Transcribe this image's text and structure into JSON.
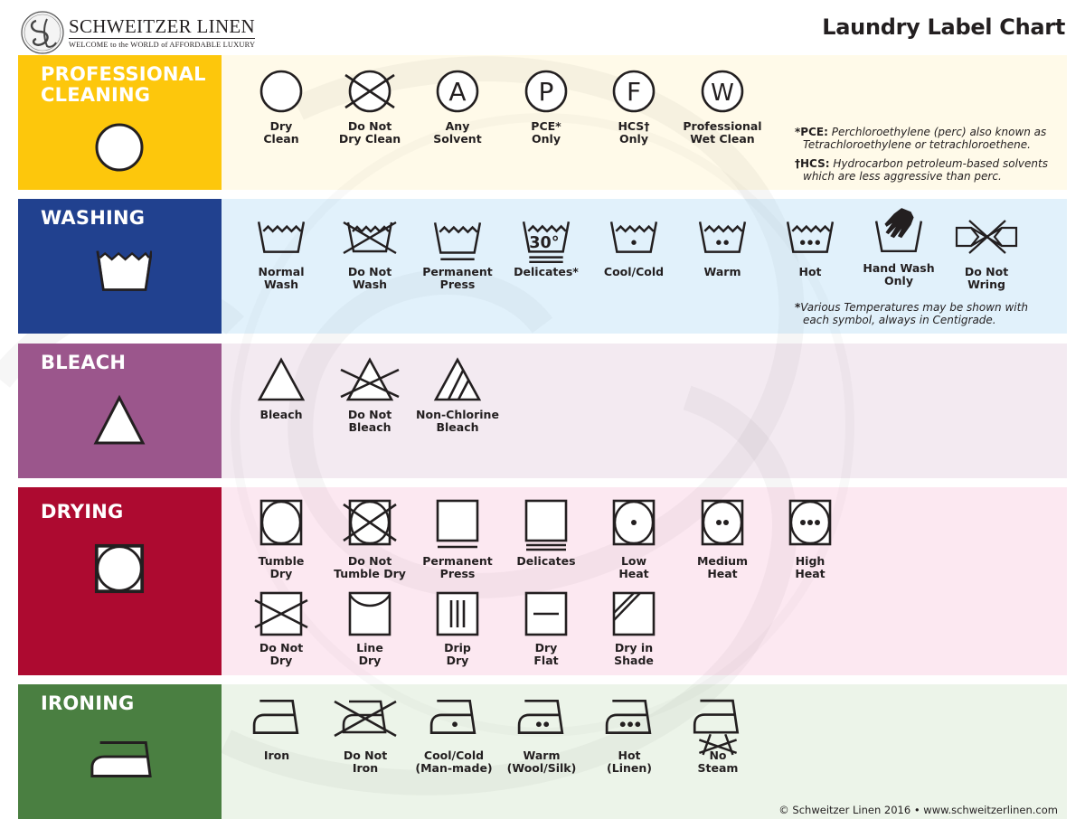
{
  "header": {
    "brand_name": "SCHWEITZER LINEN",
    "brand_tagline": "WELCOME to the WORLD of AFFORDABLE LUXURY",
    "title": "Laundry Label Chart"
  },
  "colors": {
    "professional_cleaning": "#fdc70c",
    "washing": "#21418f",
    "bleach": "#9b568c",
    "drying": "#ad0a30",
    "ironing": "#4a7f41"
  },
  "sections": {
    "professional_cleaning": {
      "title": "PROFESSIONAL\nCLEANING",
      "symbols": [
        {
          "icon": "circle-icon",
          "label": "Dry\nClean"
        },
        {
          "icon": "crossed-circle-icon",
          "label": "Do Not\nDry Clean"
        },
        {
          "icon": "circle-a-icon",
          "label": "Any\nSolvent",
          "letter": "A"
        },
        {
          "icon": "circle-p-icon",
          "label": "PCE*\nOnly",
          "letter": "P"
        },
        {
          "icon": "circle-f-icon",
          "label": "HCS†\nOnly",
          "letter": "F"
        },
        {
          "icon": "circle-w-icon",
          "label": "Professional\nWet Clean",
          "letter": "W"
        }
      ],
      "notes": [
        {
          "marker": "*",
          "term": "PCE:",
          "line1": "Perchloroethylene (perc) also known as",
          "line2": "Tetrachloroethylene or tetrachloroethene."
        },
        {
          "marker": "†",
          "term": "HCS:",
          "line1": "Hydrocarbon petroleum-based solvents",
          "line2": "which are less aggressive than perc."
        }
      ]
    },
    "washing": {
      "title": "WASHING",
      "symbols": [
        {
          "icon": "wash-tub-icon",
          "label": "Normal\nWash"
        },
        {
          "icon": "crossed-wash-tub-icon",
          "label": "Do Not\nWash"
        },
        {
          "icon": "wash-tub-one-bar-icon",
          "label": "Permanent\nPress"
        },
        {
          "icon": "wash-tub-30-two-bars-icon",
          "label": "Delicates*",
          "temp": "30°"
        },
        {
          "icon": "wash-tub-one-dot-icon",
          "label": "Cool/Cold"
        },
        {
          "icon": "wash-tub-two-dots-icon",
          "label": "Warm"
        },
        {
          "icon": "wash-tub-three-dots-icon",
          "label": "Hot"
        },
        {
          "icon": "hand-wash-icon",
          "label": "Hand Wash\nOnly"
        },
        {
          "icon": "do-not-wring-icon",
          "label": "Do Not\nWring"
        }
      ],
      "note": {
        "marker": "*",
        "line1": "Various Temperatures may be shown with",
        "line2": "each symbol, always in Centigrade."
      }
    },
    "bleach": {
      "title": "BLEACH",
      "symbols": [
        {
          "icon": "triangle-icon",
          "label": "Bleach"
        },
        {
          "icon": "crossed-triangle-icon",
          "label": "Do Not\nBleach"
        },
        {
          "icon": "striped-triangle-icon",
          "label": "Non-Chlorine\nBleach"
        }
      ]
    },
    "drying": {
      "title": "DRYING",
      "symbols_row1": [
        {
          "icon": "tumble-dry-icon",
          "label": "Tumble\nDry"
        },
        {
          "icon": "crossed-tumble-dry-icon",
          "label": "Do Not\nTumble Dry"
        },
        {
          "icon": "square-one-bar-icon",
          "label": "Permanent\nPress"
        },
        {
          "icon": "square-two-bars-icon",
          "label": "Delicates"
        },
        {
          "icon": "tumble-dry-one-dot-icon",
          "label": "Low\nHeat"
        },
        {
          "icon": "tumble-dry-two-dots-icon",
          "label": "Medium\nHeat"
        },
        {
          "icon": "tumble-dry-three-dots-icon",
          "label": "High\nHeat"
        }
      ],
      "symbols_row2": [
        {
          "icon": "crossed-square-icon",
          "label": "Do Not\nDry"
        },
        {
          "icon": "line-dry-icon",
          "label": "Line\nDry"
        },
        {
          "icon": "drip-dry-icon",
          "label": "Drip\nDry"
        },
        {
          "icon": "dry-flat-icon",
          "label": "Dry\nFlat"
        },
        {
          "icon": "dry-in-shade-icon",
          "label": "Dry in\nShade"
        }
      ]
    },
    "ironing": {
      "title": "IRONING",
      "symbols": [
        {
          "icon": "iron-icon",
          "label": "Iron"
        },
        {
          "icon": "crossed-iron-icon",
          "label": "Do Not\nIron"
        },
        {
          "icon": "iron-one-dot-icon",
          "label": "Cool/Cold\n(Man-made)"
        },
        {
          "icon": "iron-two-dots-icon",
          "label": "Warm\n(Wool/Silk)"
        },
        {
          "icon": "iron-three-dots-icon",
          "label": "Hot\n(Linen)"
        },
        {
          "icon": "iron-no-steam-icon",
          "label": "No\nSteam"
        }
      ]
    }
  },
  "footer": {
    "text": "© Schweitzer Linen 2016 • www.schweitzerlinen.com"
  }
}
